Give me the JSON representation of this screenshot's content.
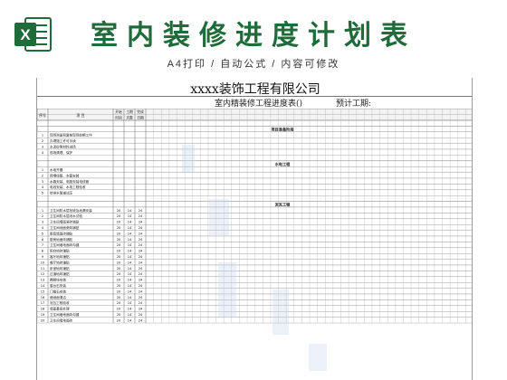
{
  "header": {
    "title": "室内装修进度计划表",
    "subtitle": "A4打印 / 自动公式 / 内容可修改",
    "app_icon": "excel-icon",
    "accent": "#1f6b3a"
  },
  "sheet": {
    "company": "xxxx装饰工程有限公司",
    "plan_title": "室内精装修工程进度表()",
    "plan_period": "预计工期:",
    "col_seq": "序号",
    "col_item": "项    目",
    "col_plan": "开始",
    "col_days": "工期",
    "col_done": "完成",
    "col_time": "时间",
    "col_day": "天数",
    "col_date": "日期",
    "sections": [
      {
        "name": "项目准备阶段",
        "rows": [
          {
            "no": "1",
            "item": "现场测量和复核现场前期工作",
            "start": "",
            "days": "",
            "end": ""
          },
          {
            "no": "2",
            "item": "办理施工许可手续",
            "start": "",
            "days": "",
            "end": ""
          },
          {
            "no": "3",
            "item": "水泥砂等材料进场",
            "start": "",
            "days": "",
            "end": ""
          },
          {
            "no": "4",
            "item": "现场清理、保护",
            "start": "",
            "days": "",
            "end": ""
          }
        ]
      },
      {
        "name": "水电工程",
        "rows": [
          {
            "no": "1",
            "item": "水电开槽",
            "start": "",
            "days": "",
            "end": ""
          },
          {
            "no": "2",
            "item": "预埋线管、水管安装",
            "start": "",
            "days": "",
            "end": ""
          },
          {
            "no": "3",
            "item": "水路安装、电路安装电线管",
            "start": "",
            "days": "",
            "end": ""
          },
          {
            "no": "4",
            "item": "电线安装、水电工程验收",
            "start": "",
            "days": "",
            "end": ""
          },
          {
            "no": "5",
            "item": "给排水管道试压",
            "start": "",
            "days": "",
            "end": ""
          }
        ]
      },
      {
        "name": "泥瓦工程",
        "rows": [
          {
            "no": "1",
            "item": "卫生间防水层找坡及地漏安装",
            "start": "20",
            "days": "14",
            "end": "24"
          },
          {
            "no": "2",
            "item": "卫生间防水层闭水试验",
            "start": "20",
            "days": "14",
            "end": "24"
          },
          {
            "no": "3",
            "item": "卫生间墙面瓷砖铺贴",
            "start": "20",
            "days": "14",
            "end": "24"
          },
          {
            "no": "4",
            "item": "卫生间地面瓷砖铺贴",
            "start": "20",
            "days": "14",
            "end": "24"
          },
          {
            "no": "5",
            "item": "厨房墙面砖铺贴",
            "start": "20",
            "days": "14",
            "end": "24"
          },
          {
            "no": "6",
            "item": "厨房地面砖铺贴",
            "start": "20",
            "days": "14",
            "end": "24"
          },
          {
            "no": "7",
            "item": "卫生间墙地面砖勾缝",
            "start": "20",
            "days": "14",
            "end": "24"
          },
          {
            "no": "8",
            "item": "阳台地砖铺贴",
            "start": "20",
            "days": "14",
            "end": "24"
          },
          {
            "no": "9",
            "item": "客厅地砖铺贴",
            "start": "20",
            "days": "14",
            "end": "24"
          },
          {
            "no": "10",
            "item": "餐厅地砖铺贴",
            "start": "20",
            "days": "14",
            "end": "24"
          },
          {
            "no": "11",
            "item": "卧室地砖铺贴",
            "start": "20",
            "days": "14",
            "end": "24"
          },
          {
            "no": "12",
            "item": "过道地砖铺贴",
            "start": "20",
            "days": "14",
            "end": "24"
          },
          {
            "no": "13",
            "item": "踢脚线安装",
            "start": "20",
            "days": "14",
            "end": "24"
          },
          {
            "no": "14",
            "item": "窗台石安装",
            "start": "20",
            "days": "14",
            "end": "24"
          },
          {
            "no": "15",
            "item": "门槛石安装",
            "start": "20",
            "days": "14",
            "end": "24"
          },
          {
            "no": "16",
            "item": "墙地面清洁",
            "start": "20",
            "days": "14",
            "end": "24"
          },
          {
            "no": "17",
            "item": "泥瓦工程验收",
            "start": "20",
            "days": "14",
            "end": "24"
          },
          {
            "no": "18",
            "item": "墙面基层处理",
            "start": "20",
            "days": "14",
            "end": "24"
          },
          {
            "no": "19",
            "item": "卫生间墙地面砖勾缝",
            "start": "20",
            "days": "14",
            "end": "24"
          },
          {
            "no": "20",
            "item": "卫生间墙地面砖",
            "start": "20",
            "days": "14",
            "end": "24"
          }
        ]
      }
    ]
  }
}
